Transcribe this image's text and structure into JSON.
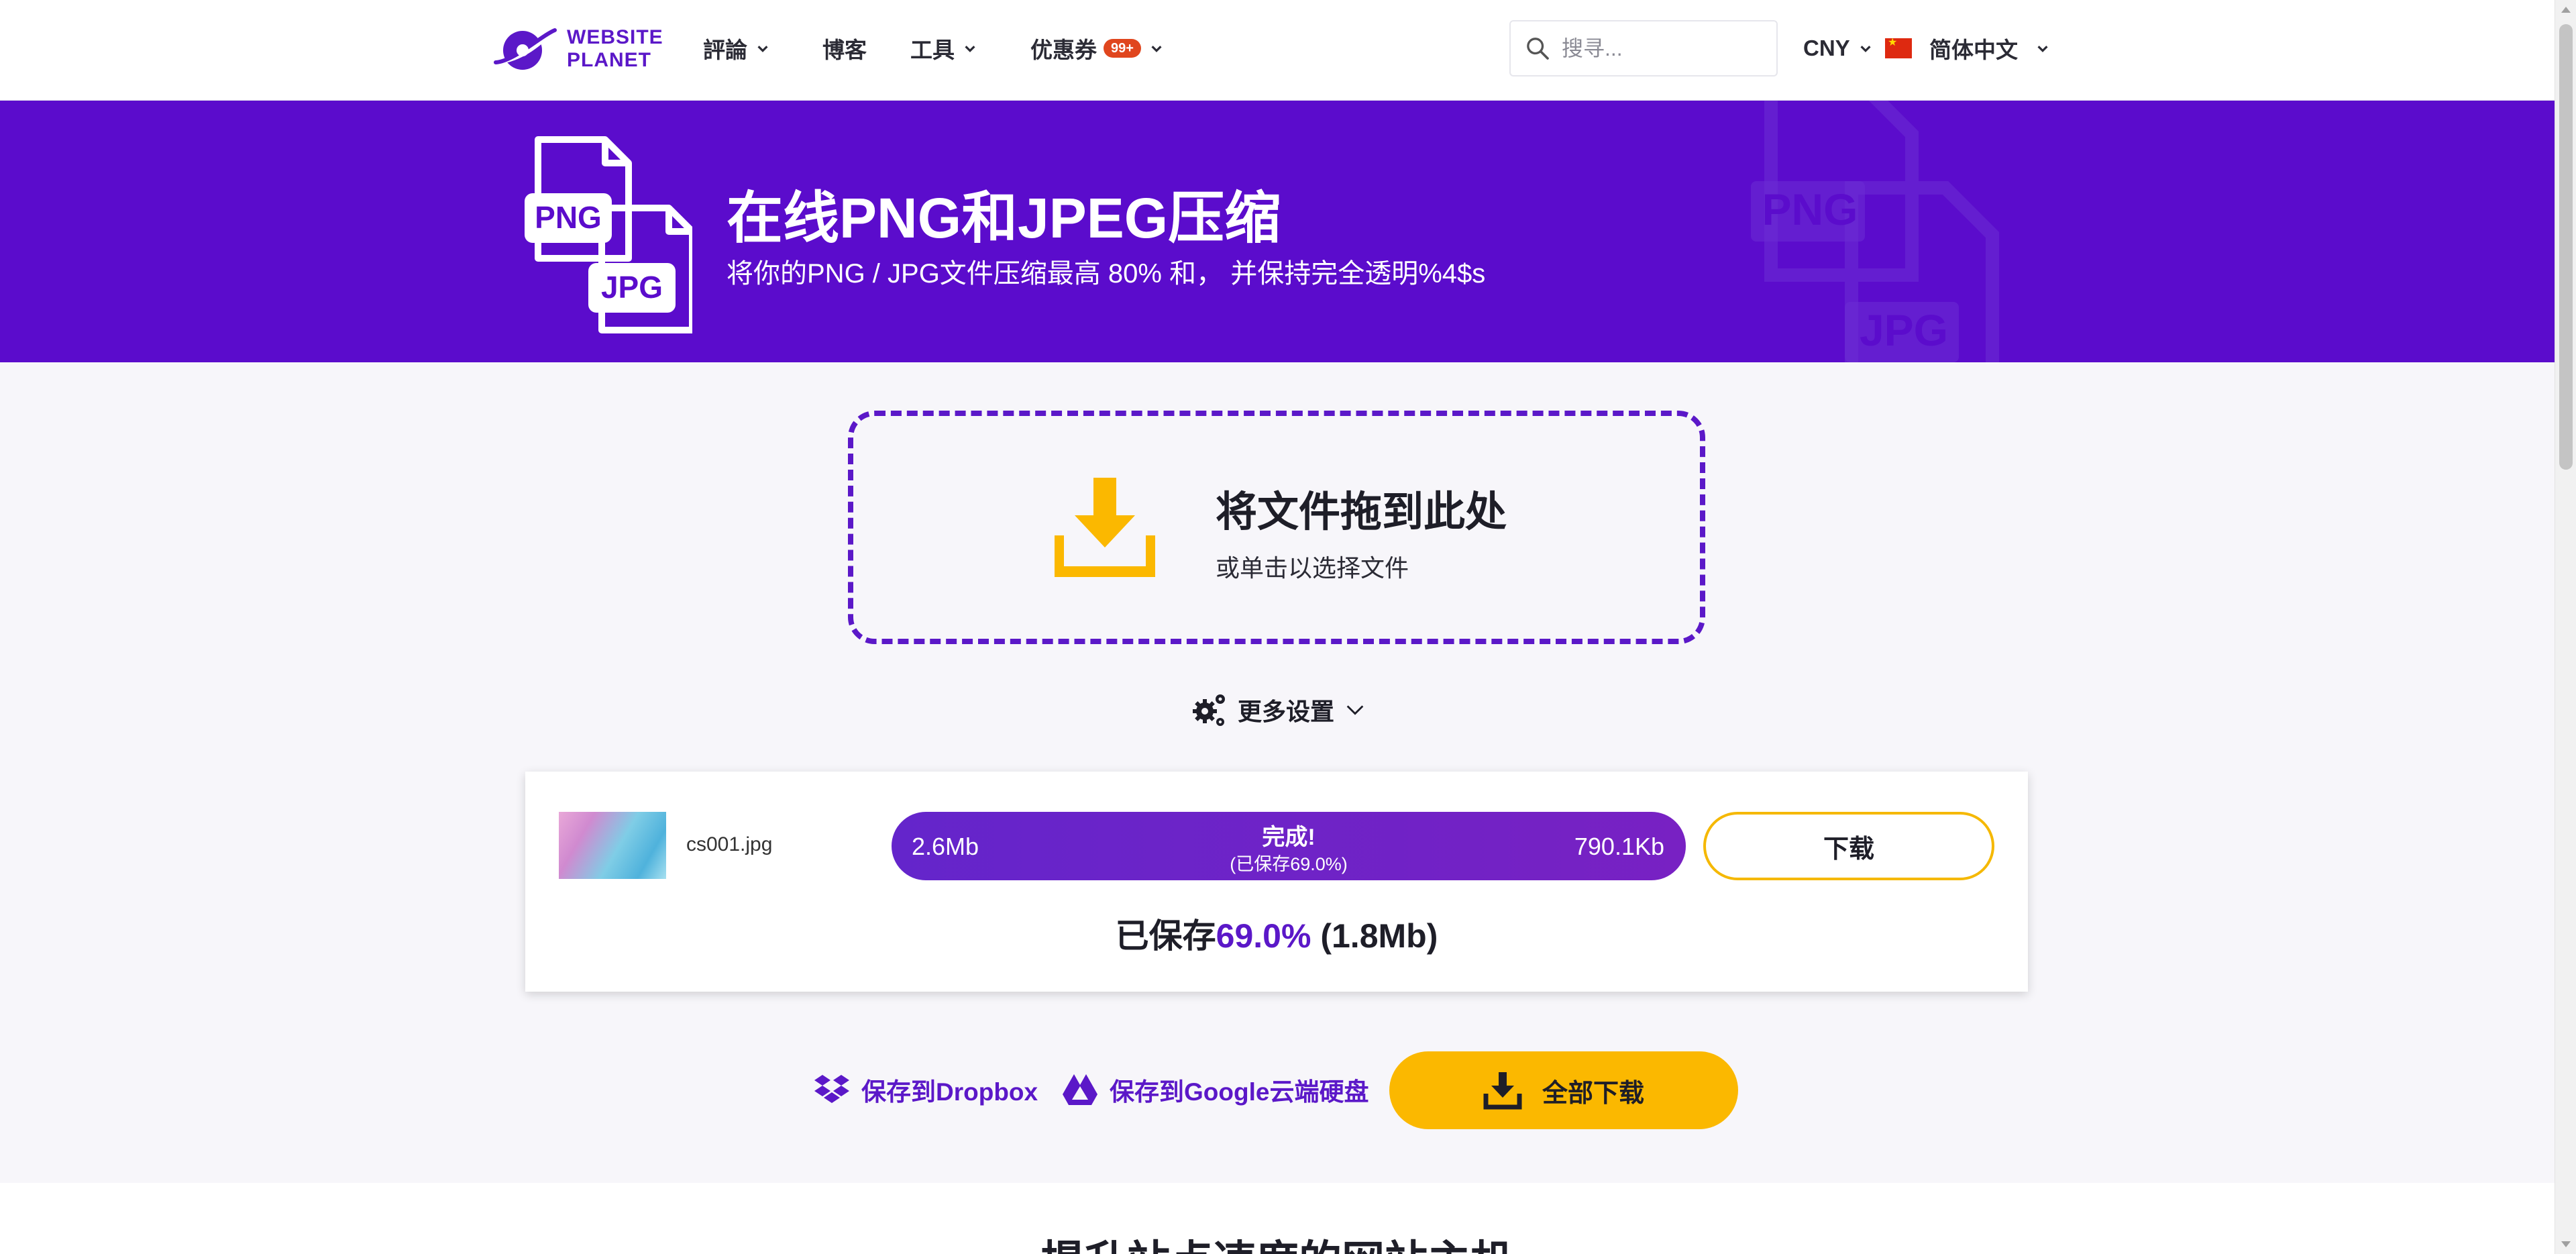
{
  "header": {
    "logo_line1": "WEBSITE",
    "logo_line2": "PLANET",
    "nav": {
      "reviews": "評論",
      "blog": "博客",
      "tools": "工具",
      "coupons": "优惠券",
      "coupons_badge": "99+"
    },
    "search_placeholder": "搜寻...",
    "currency": "CNY",
    "language": "简体中文"
  },
  "hero": {
    "title": "在线PNG和JPEG压缩",
    "subtitle": "将你的PNG / JPG文件压缩最高 80% 和， 并保持完全透明%4$s",
    "icon_labels": [
      "PNG",
      "JPG"
    ]
  },
  "dropzone": {
    "title": "将文件拖到此处",
    "subtitle": "或单击以选择文件"
  },
  "settings_label": "更多设置",
  "result": {
    "filename": "cs001.jpg",
    "original_size": "2.6Mb",
    "compressed_size": "790.1Kb",
    "status": "完成!",
    "status_note": "(已保存69.0%)",
    "progress": 1.0,
    "download_label": "下载",
    "saved_prefix": "已保存",
    "saved_percent": "69.0%",
    "saved_amount": "(1.8Mb)"
  },
  "actions": {
    "dropbox": "保存到Dropbox",
    "gdrive": "保存到Google云端硬盘",
    "download_all": "全部下载"
  },
  "lower_heading": "提升站点速度的网站主机",
  "colors": {
    "brand_purple": "#5b0ccc",
    "accent_yellow": "#fbb800",
    "badge_red": "#e0461e"
  }
}
